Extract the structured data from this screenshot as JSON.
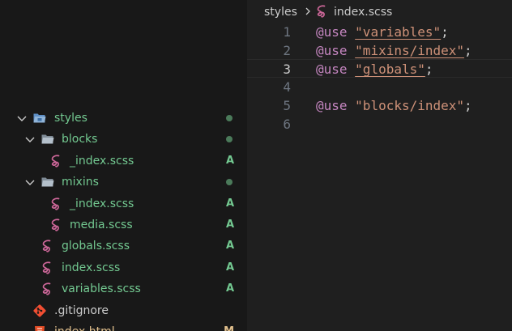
{
  "colors": {
    "sidebar_bg": "#181818",
    "editor_bg": "#1f1f1f",
    "added_green": "#73c991",
    "modified_tan": "#e2c08d",
    "sass_pink": "#cd6799",
    "folder_blue": "#90b4d8",
    "git_orange": "#f14e32"
  },
  "explorer": {
    "items": [
      {
        "label": "styles",
        "type": "folder-open",
        "status_dot": true
      },
      {
        "label": "blocks",
        "type": "folder-open",
        "status_dot": true
      },
      {
        "label": "_index.scss",
        "type": "scss",
        "status": "A"
      },
      {
        "label": "mixins",
        "type": "folder-open",
        "status_dot": true
      },
      {
        "label": "_index.scss",
        "type": "scss",
        "status": "A"
      },
      {
        "label": "media.scss",
        "type": "scss",
        "status": "A"
      },
      {
        "label": "globals.scss",
        "type": "scss",
        "status": "A"
      },
      {
        "label": "index.scss",
        "type": "scss",
        "status": "A"
      },
      {
        "label": "variables.scss",
        "type": "scss",
        "status": "A"
      },
      {
        "label": ".gitignore",
        "type": "git"
      },
      {
        "label": "index.html",
        "type": "html",
        "status": "M"
      }
    ]
  },
  "breadcrumb": {
    "folder": "styles",
    "file": "index.scss",
    "file_icon": "sass-icon",
    "separator_icon": "chevron-right-icon"
  },
  "editor": {
    "active_line": 3,
    "lines": [
      {
        "number": "1",
        "keyword": "@use",
        "string": "\"variables\"",
        "end": ";"
      },
      {
        "number": "2",
        "keyword": "@use",
        "string": "\"mixins/index\"",
        "end": ";"
      },
      {
        "number": "3",
        "keyword": "@use",
        "string": "\"globals\"",
        "end": ";"
      },
      {
        "number": "4",
        "keyword": "",
        "string": "",
        "end": ""
      },
      {
        "number": "5",
        "keyword": "@use",
        "string": "\"blocks/index\"",
        "end": ";"
      },
      {
        "number": "6",
        "keyword": "",
        "string": "",
        "end": ""
      }
    ]
  }
}
